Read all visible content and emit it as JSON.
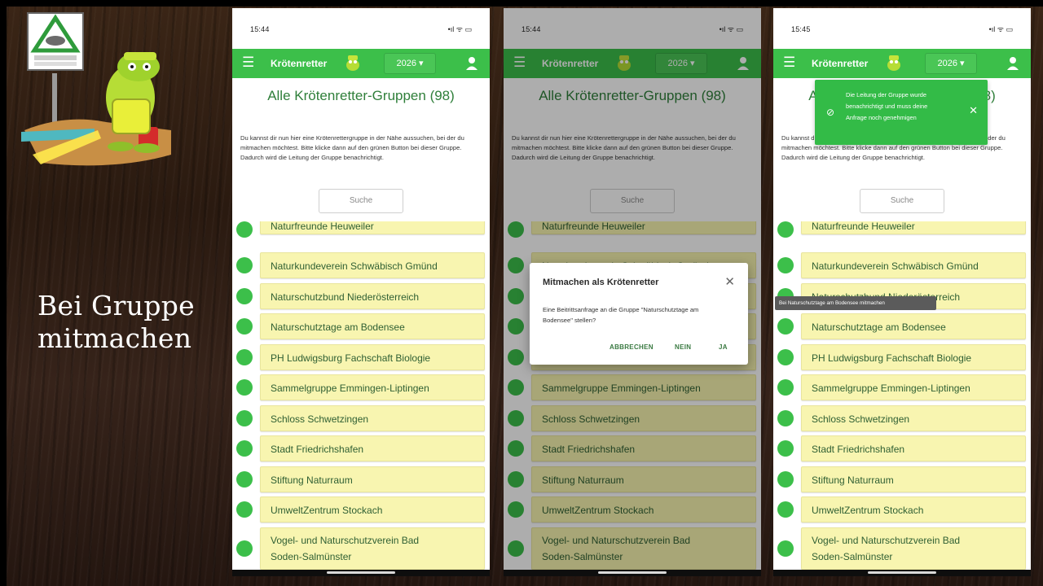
{
  "slide": {
    "title_line1": "Bei Gruppe",
    "title_line2": "mitmachen"
  },
  "logo": {
    "icon": "toad-rescuer-mascot-icon"
  },
  "colors": {
    "app_green": "#3cbf4a",
    "card_yellow": "#f8f5b0",
    "heading_green": "#2f7f3a",
    "toast_green": "#33bb47"
  },
  "app": {
    "title": "Krötenretter",
    "year": "2026 ▾",
    "heading": "Alle Krötenretter-Gruppen (98)",
    "intro": "Du kannst dir nun hier eine Krötenrettergruppe in der Nähe aussuchen, bei der du mitmachen möchtest. Bitte klicke dann auf den grünen Button bei dieser Gruppe. Dadurch wird die Leitung der Gruppe benachrichtigt.",
    "search_placeholder": "Suche",
    "groups": [
      "Naturfreunde Heuweiler",
      "Naturkundeverein Schwäbisch Gmünd",
      "Naturschutzbund Niederösterreich",
      "Naturschutztage am Bodensee",
      "PH Ludwigsburg Fachschaft Biologie",
      "Sammelgruppe Emmingen-Liptingen",
      "Schloss Schwetzingen",
      "Stadt Friedrichshafen",
      "Stiftung Naturraum",
      "UmweltZentrum Stockach",
      "Vogel- und Naturschutzverein Bad Soden-Salmünster"
    ]
  },
  "phones": [
    {
      "time": "15:44",
      "status_icons": "•ıl ᯤ ▭"
    },
    {
      "time": "15:44",
      "status_icons": "•ıl ᯤ ▭"
    },
    {
      "time": "15:45",
      "status_icons": "•ıl ᯤ ▭"
    }
  ],
  "dialog": {
    "title": "Mitmachen als Krötenretter",
    "text": "Eine Beitrittsanfrage an die Gruppe \"Naturschutztage am Bodensee\" stellen?",
    "cancel": "ABBRECHEN",
    "no": "NEIN",
    "yes": "JA"
  },
  "toast": {
    "text": "Die Leitung der Gruppe wurde benachrichtigt und muss deine Anfrage noch genehmigen"
  },
  "tooltip": {
    "text": "Bei Naturschutztage am Bodensee mitmachen"
  }
}
